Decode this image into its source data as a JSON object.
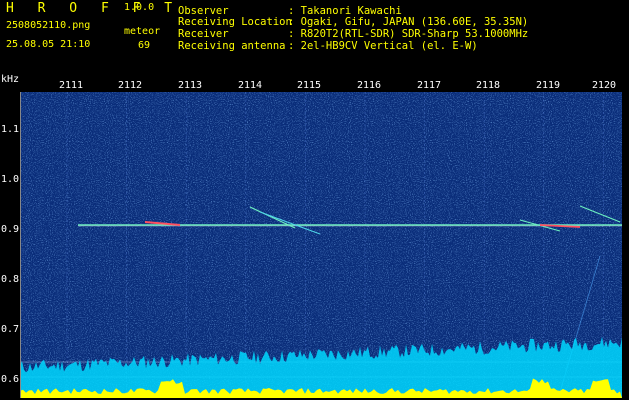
{
  "header": {
    "app_title": "H R O F F T",
    "app_version": "1.0.0",
    "file_name": "2508052110.png",
    "date_time": "25.08.05 21:10",
    "mode_label": "meteor",
    "count_value": "69",
    "info": [
      {
        "label": "Observer",
        "value": ": Takanori Kawachi"
      },
      {
        "label": "Receiving Location",
        "value": ": Ogaki, Gifu, JAPAN (136.60E, 35.35N)"
      },
      {
        "label": "Receiver",
        "value": ": R820T2(RTL-SDR) SDR-Sharp 53.1000MHz"
      },
      {
        "label": "Receiving antenna",
        "value": ": 2el-HB9CV Vertical (el. E-W)"
      }
    ]
  },
  "plot": {
    "unit_label": "kHz",
    "y_ticks": [
      "1.1",
      "1.0",
      "0.9",
      "0.8",
      "0.7",
      "0.6"
    ],
    "x_ticks": [
      "2111",
      "2112",
      "2113",
      "2114",
      "2115",
      "2116",
      "2117",
      "2118",
      "2119",
      "2120"
    ]
  },
  "colors": {
    "background": "#000000",
    "header_text_yellow": "#ffff00",
    "header_text_white": "#ffffff",
    "waterfall_base": "#0a2d7a",
    "carrier_line": "#6cf0c0",
    "baseline_fill": "#ffff00",
    "baseline_fill_2": "#00e6ff"
  }
}
